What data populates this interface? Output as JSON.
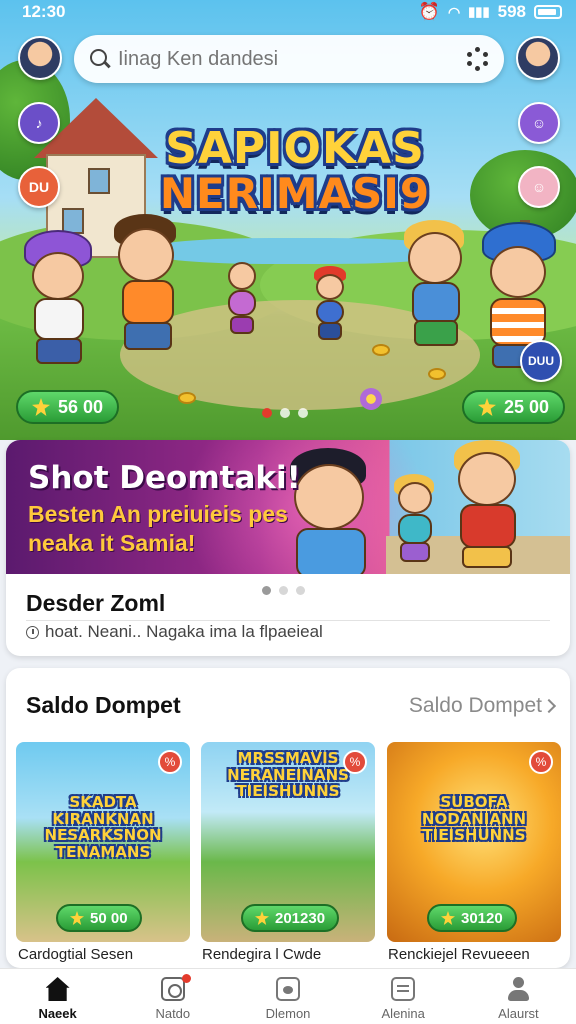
{
  "status_bar": {
    "time": "12:30",
    "battery": "598"
  },
  "search": {
    "placeholder": "Iinag Ken dandesi"
  },
  "hero": {
    "title_line1": "SAPIOKAS",
    "title_line2": "NERIMASI9",
    "side_badge_top": "DU",
    "side_badge_bottom": "DUU",
    "left_reward": "56 00",
    "right_reward": "25 00",
    "slides": 3,
    "active_slide": 1
  },
  "promo": {
    "title": "Shot Deomtaki!",
    "subtitle": "Besten An preiuieis pes neaka it Samia!",
    "heading": "Desder Zoml",
    "description": "hoat. Neani.. Nagaka ima la flpaeieal",
    "slides": 3,
    "active_slide": 1
  },
  "wallet": {
    "title": "Saldo Dompet",
    "link": "Saldo Dompet",
    "games": [
      {
        "art_title": "SKADTA KIRANKNAN NESARKSNON TENAMANS",
        "price": "50 00",
        "name": "Cardogtial Sesen"
      },
      {
        "art_title": "MRSSMAVIS NERANEINANS TIEISHUNNS",
        "price": "201230",
        "name": "Rendegira l Cwde"
      },
      {
        "art_title": "SUBOFA NODANIANN TIEISHUNNS",
        "price": "30120",
        "name": "Renckiejel Revueeen"
      }
    ]
  },
  "bottom_nav": [
    {
      "label": "Naeek",
      "icon": "home-icon",
      "active": true
    },
    {
      "label": "Natdo",
      "icon": "target-icon",
      "active": false,
      "notification": true
    },
    {
      "label": "Dlemon",
      "icon": "game-icon",
      "active": false
    },
    {
      "label": "Alenina",
      "icon": "list-icon",
      "active": false
    },
    {
      "label": "Alaurst",
      "icon": "user-icon",
      "active": false
    }
  ],
  "colors": {
    "accent_green": "#2a9c36",
    "notification_red": "#e43b2c",
    "title_yellow": "#ffd23a",
    "title_orange": "#ff8a1c",
    "promo_purple": "#9c2b8a"
  }
}
